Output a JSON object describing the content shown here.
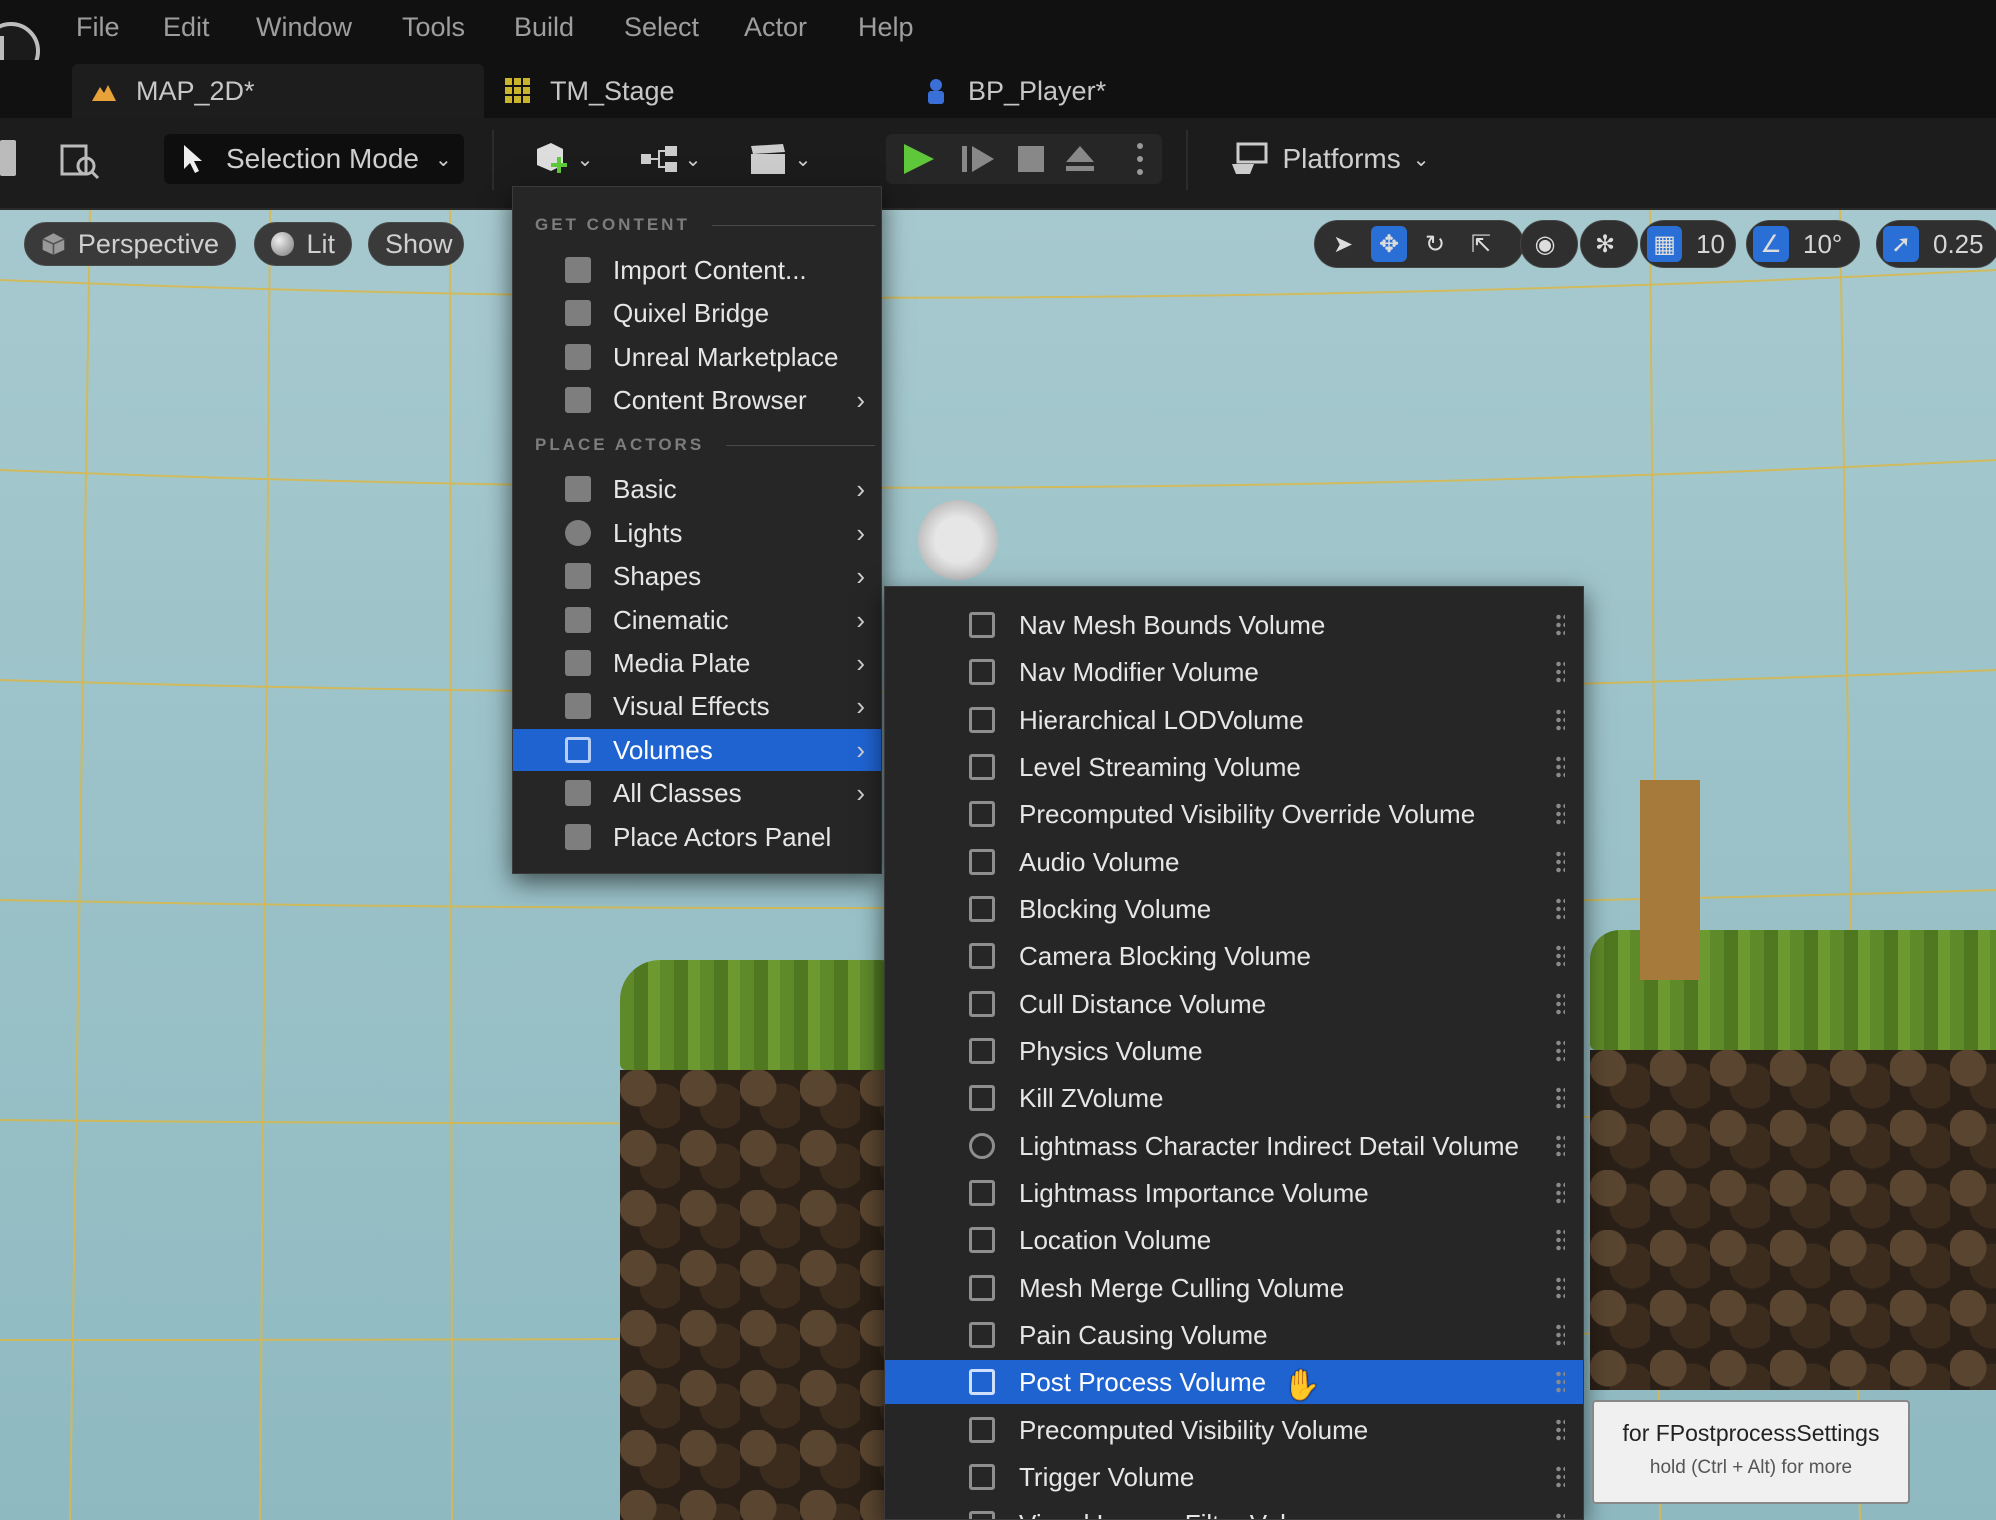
{
  "menubar": {
    "items": [
      "File",
      "Edit",
      "Window",
      "Tools",
      "Build",
      "Select",
      "Actor",
      "Help"
    ]
  },
  "tabs": [
    {
      "label": "MAP_2D*",
      "icon": "level-icon"
    },
    {
      "label": "TM_Stage",
      "icon": "tilemap-icon"
    },
    {
      "label": "BP_Player*",
      "icon": "blueprint-icon"
    }
  ],
  "toolbar": {
    "selection_mode": "Selection Mode",
    "platforms": "Platforms"
  },
  "viewport": {
    "perspective": "Perspective",
    "lit": "Lit",
    "show": "Show",
    "grid_snap": "10",
    "rotation_snap": "10°",
    "scale_snap": "0.25"
  },
  "dropdown": {
    "sections": [
      "GET CONTENT",
      "PLACE ACTORS"
    ],
    "get_content": [
      {
        "label": "Import Content...",
        "submenu": false
      },
      {
        "label": "Quixel Bridge",
        "submenu": false
      },
      {
        "label": "Unreal Marketplace",
        "submenu": false
      },
      {
        "label": "Content Browser",
        "submenu": true
      }
    ],
    "place_actors": [
      {
        "label": "Basic",
        "submenu": true
      },
      {
        "label": "Lights",
        "submenu": true
      },
      {
        "label": "Shapes",
        "submenu": true
      },
      {
        "label": "Cinematic",
        "submenu": true
      },
      {
        "label": "Media Plate",
        "submenu": true
      },
      {
        "label": "Visual Effects",
        "submenu": true
      },
      {
        "label": "Volumes",
        "submenu": true,
        "selected": true
      },
      {
        "label": "All Classes",
        "submenu": true
      },
      {
        "label": "Place Actors Panel",
        "submenu": false
      }
    ]
  },
  "volumes_submenu": [
    "Nav Mesh Bounds Volume",
    "Nav Modifier Volume",
    "Hierarchical LODVolume",
    "Level Streaming Volume",
    "Precomputed Visibility Override Volume",
    "Audio Volume",
    "Blocking Volume",
    "Camera Blocking Volume",
    "Cull Distance Volume",
    "Physics Volume",
    "Kill ZVolume",
    "Lightmass Character Indirect Detail Volume",
    "Lightmass Importance Volume",
    "Location Volume",
    "Mesh Merge Culling Volume",
    "Pain Causing Volume",
    "Post Process Volume",
    "Precomputed Visibility Volume",
    "Trigger Volume",
    "Visual Logger Filter Volume"
  ],
  "selected_volume": "Post Process Volume",
  "tooltip": {
    "line1": "for FPostprocessSettings",
    "line2": "hold (Ctrl + Alt) for more"
  },
  "colors": {
    "accent": "#1f63d1",
    "play_green": "#5fc73a",
    "grid_line": "#d9b84a"
  }
}
